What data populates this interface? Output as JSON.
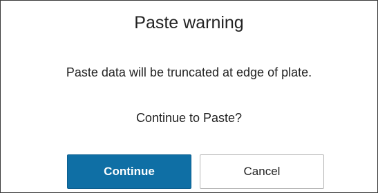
{
  "dialog": {
    "title": "Paste warning",
    "message": "Paste data will be truncated at edge of plate.",
    "question": "Continue to Paste?",
    "buttons": {
      "continue_label": "Continue",
      "cancel_label": "Cancel"
    }
  },
  "colors": {
    "primary_button": "#0f6fa5",
    "border": "#3a3a3a"
  }
}
